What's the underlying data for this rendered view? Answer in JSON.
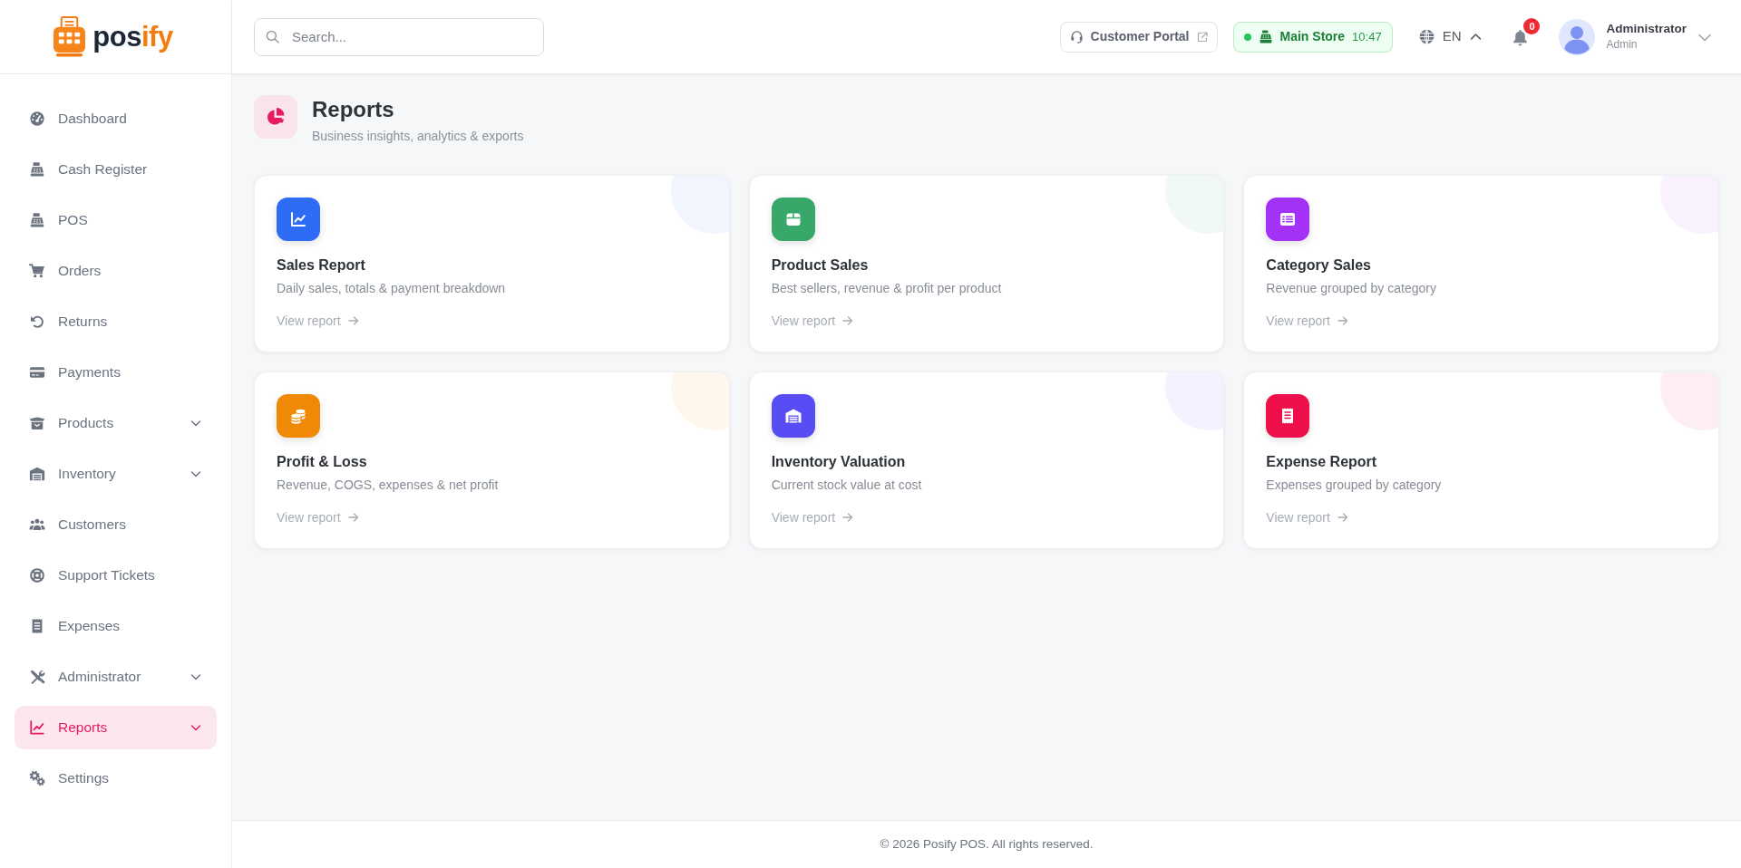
{
  "sidebar": {
    "logo": {
      "text": "pos",
      "accent_text": "ify"
    },
    "items": [
      {
        "label": "Dashboard",
        "kind": "link",
        "selected": false
      },
      {
        "label": "Cash Register",
        "kind": "link",
        "selected": false
      },
      {
        "label": "POS",
        "kind": "link",
        "selected": false
      },
      {
        "label": "Orders",
        "kind": "link",
        "selected": false
      },
      {
        "label": "Returns",
        "kind": "link",
        "selected": false
      },
      {
        "label": "Payments",
        "kind": "link",
        "selected": false
      },
      {
        "label": "Products",
        "kind": "group",
        "selected": false
      },
      {
        "label": "Inventory",
        "kind": "group",
        "selected": false
      },
      {
        "label": "Customers",
        "kind": "link",
        "selected": false
      },
      {
        "label": "Support Tickets",
        "kind": "link",
        "selected": false
      },
      {
        "label": "Expenses",
        "kind": "link",
        "selected": false
      },
      {
        "label": "Administrator",
        "kind": "group",
        "selected": false
      },
      {
        "label": "Reports",
        "kind": "group",
        "selected": true
      },
      {
        "label": "Settings",
        "kind": "link",
        "selected": false
      }
    ]
  },
  "header": {
    "search": {
      "placeholder": "Search..."
    },
    "portal_button": {
      "label": "Customer Portal"
    },
    "store": {
      "name": "Main Store",
      "time": "10:47",
      "online": true
    },
    "language": {
      "code": "EN"
    },
    "notifications": {
      "count": "0"
    },
    "user": {
      "name": "Administrator",
      "role": "Admin"
    }
  },
  "page": {
    "title": "Reports",
    "subtitle": "Business insights, analytics & exports"
  },
  "cards": [
    {
      "title": "Sales Report",
      "description": "Daily sales, totals & payment breakdown",
      "link": "View report",
      "color": "#2f6cf6"
    },
    {
      "title": "Product Sales",
      "description": "Best sellers, revenue & profit per product",
      "link": "View report",
      "color": "#37a76a"
    },
    {
      "title": "Category Sales",
      "description": "Revenue grouped by category",
      "link": "View report",
      "color": "#a332f6"
    },
    {
      "title": "Profit & Loss",
      "description": "Revenue, COGS, expenses & net profit",
      "link": "View report",
      "color": "#f08a06"
    },
    {
      "title": "Inventory Valuation",
      "description": "Current stock value at cost",
      "link": "View report",
      "color": "#584cf5"
    },
    {
      "title": "Expense Report",
      "description": "Expenses grouped by category",
      "link": "View report",
      "color": "#ef104b"
    }
  ],
  "footer": {
    "text": "© 2026 Posify POS. All rights reserved."
  }
}
